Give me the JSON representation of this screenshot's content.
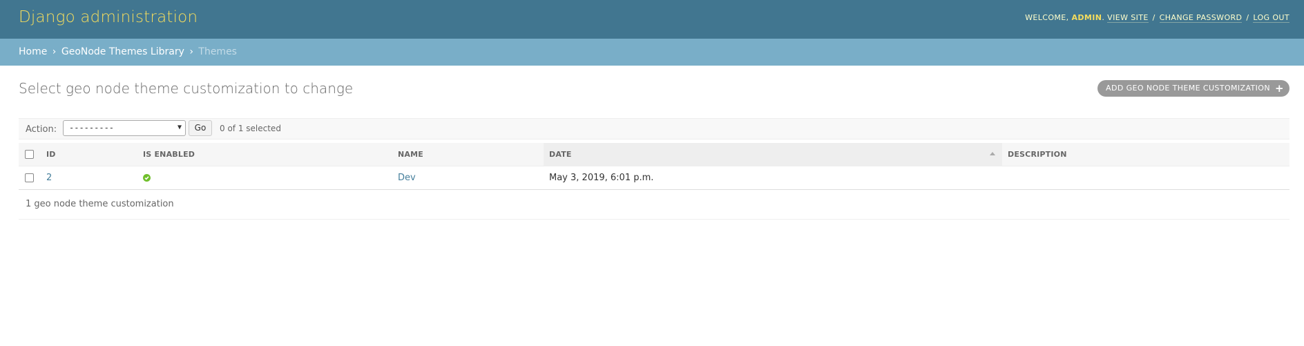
{
  "header": {
    "site_name": "Django administration",
    "welcome_label": "WELCOME,",
    "username": "ADMIN",
    "view_site": "VIEW SITE",
    "change_password": "CHANGE PASSWORD",
    "log_out": "LOG OUT",
    "separator": "/"
  },
  "breadcrumbs": {
    "home": "Home",
    "app": "GeoNode Themes Library",
    "current": "Themes",
    "separator": "›"
  },
  "content": {
    "title": "Select geo node theme customization to change",
    "add_button": "ADD GEO NODE THEME CUSTOMIZATION",
    "add_icon": "+"
  },
  "actions": {
    "label": "Action:",
    "selected_option": "---------",
    "go_label": "Go",
    "selection_count": "0 of 1 selected"
  },
  "table": {
    "columns": [
      "ID",
      "IS ENABLED",
      "NAME",
      "DATE",
      "DESCRIPTION"
    ],
    "sorted_column": "DATE",
    "rows": [
      {
        "id": "2",
        "is_enabled": true,
        "name": "Dev",
        "date": "May 3, 2019, 6:01 p.m.",
        "description": ""
      }
    ]
  },
  "paginator": {
    "text": "1 geo node theme customization"
  },
  "colors": {
    "header_bg": "#417690",
    "breadcrumbs_bg": "#79aec8",
    "site_name": "#f5dd5d",
    "link": "#447e9b",
    "enabled_icon": "#70bf2b"
  }
}
